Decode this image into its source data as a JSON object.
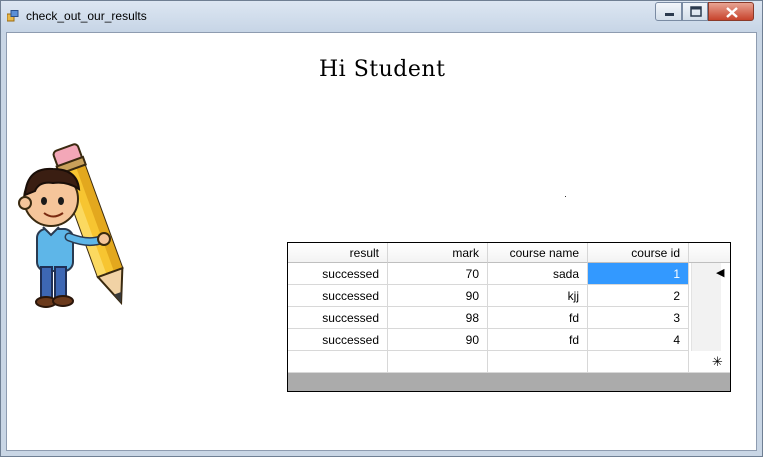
{
  "window": {
    "title": "check_out_our_results"
  },
  "main": {
    "greeting": "Hi Student"
  },
  "grid": {
    "columns": [
      "result",
      "mark",
      "course name",
      "course id"
    ],
    "rows": [
      [
        "successed",
        "70",
        "sada",
        "1"
      ],
      [
        "successed",
        "90",
        "kjj",
        "2"
      ],
      [
        "successed",
        "98",
        "fd",
        "3"
      ],
      [
        "successed",
        "90",
        "fd",
        "4"
      ]
    ],
    "current_row_marker": "◀",
    "new_row_marker": "✳",
    "selection_color": "#3399ff"
  }
}
